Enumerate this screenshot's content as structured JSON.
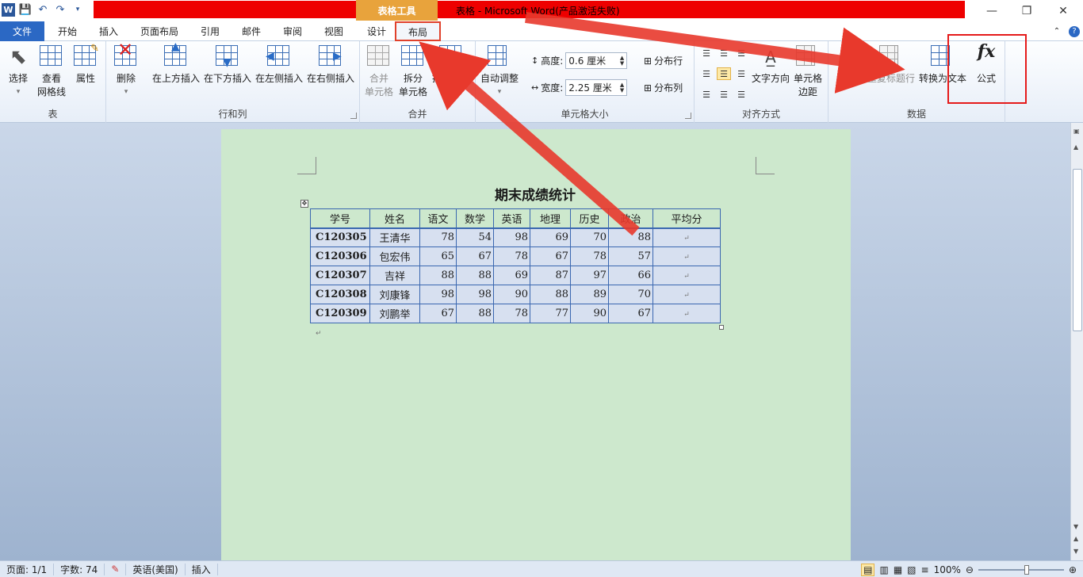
{
  "window": {
    "title": "表格 - Microsoft Word(产品激活失败)",
    "context_tab_title": "表格工具",
    "minimize": "—",
    "restore": "❐",
    "close": "✕"
  },
  "tabs": [
    "文件",
    "开始",
    "插入",
    "页面布局",
    "引用",
    "邮件",
    "审阅",
    "视图",
    "设计",
    "布局"
  ],
  "ribbon": {
    "group_table": {
      "label": "表",
      "select": "选择",
      "view_gridlines_1": "查看",
      "view_gridlines_2": "网格线",
      "properties": "属性"
    },
    "group_rows_cols": {
      "label": "行和列",
      "delete": "删除",
      "insert_above": "在上方插入",
      "insert_below": "在下方插入",
      "insert_left": "在左侧插入",
      "insert_right": "在右侧插入"
    },
    "group_merge": {
      "label": "合并",
      "merge_1": "合并",
      "merge_2": "单元格",
      "split_1": "拆分",
      "split_2": "单元格",
      "split_table": "拆分表格"
    },
    "group_cell_size": {
      "label": "单元格大小",
      "autofit": "自动调整",
      "height_label": "高度:",
      "height_value": "0.6 厘米",
      "width_label": "宽度:",
      "width_value": "2.25 厘米",
      "distribute_rows": "分布行",
      "distribute_cols": "分布列"
    },
    "group_alignment": {
      "label": "对齐方式",
      "text_direction": "文字方向",
      "cell_margins_1": "单元格",
      "cell_margins_2": "边距"
    },
    "group_data": {
      "label": "数据",
      "sort": "排序",
      "repeat_header": "重复标题行",
      "convert_to_text": "转换为文本",
      "formula": "公式",
      "formula_icon": "fx"
    }
  },
  "document": {
    "title": "期末成绩统计",
    "headers": [
      "学号",
      "姓名",
      "语文",
      "数学",
      "英语",
      "地理",
      "历史",
      "政治",
      "平均分"
    ],
    "rows": [
      [
        "C120305",
        "王清华",
        "78",
        "54",
        "98",
        "69",
        "70",
        "88",
        ""
      ],
      [
        "C120306",
        "包宏伟",
        "65",
        "67",
        "78",
        "67",
        "78",
        "57",
        ""
      ],
      [
        "C120307",
        "吉祥",
        "88",
        "88",
        "69",
        "87",
        "97",
        "66",
        ""
      ],
      [
        "C120308",
        "刘康锋",
        "98",
        "98",
        "90",
        "88",
        "89",
        "70",
        ""
      ],
      [
        "C120309",
        "刘鹏举",
        "67",
        "88",
        "78",
        "77",
        "90",
        "67",
        ""
      ]
    ]
  },
  "status": {
    "page": "页面: 1/1",
    "words": "字数: 74",
    "language": "英语(美国)",
    "mode": "插入",
    "zoom": "100%",
    "zoom_fraction": 0.57
  },
  "annotation_color": "#e51a1a"
}
